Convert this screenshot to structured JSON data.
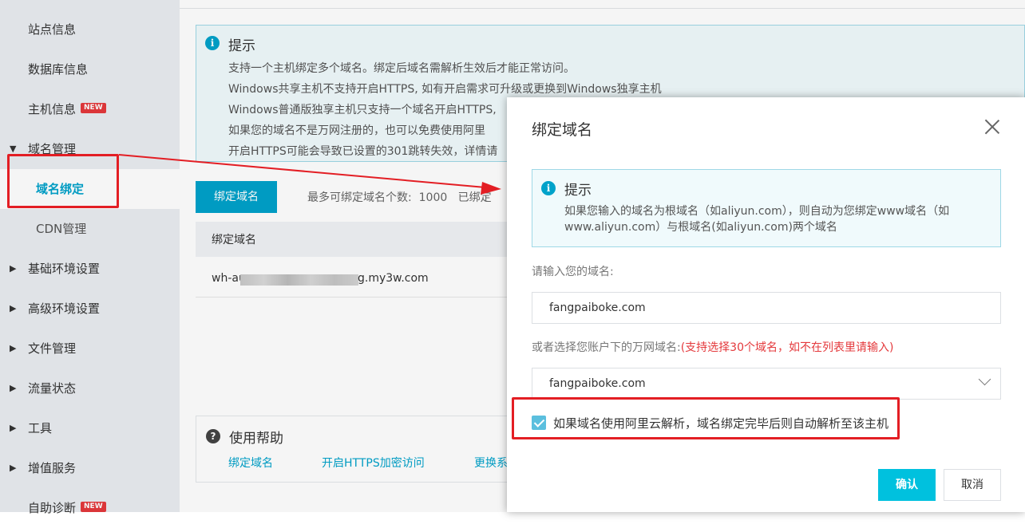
{
  "sidebar": {
    "items": [
      {
        "label": "站点信息",
        "arrow": ""
      },
      {
        "label": "数据库信息",
        "arrow": ""
      },
      {
        "label": "主机信息",
        "arrow": "",
        "badge": "NEW"
      },
      {
        "label": "域名管理",
        "arrow": "▼"
      },
      {
        "label": "域名绑定",
        "arrow": ""
      },
      {
        "label": "CDN管理",
        "arrow": ""
      },
      {
        "label": "基础环境设置",
        "arrow": "▶"
      },
      {
        "label": "高级环境设置",
        "arrow": "▶"
      },
      {
        "label": "文件管理",
        "arrow": "▶"
      },
      {
        "label": "流量状态",
        "arrow": "▶"
      },
      {
        "label": "工具",
        "arrow": "▶"
      },
      {
        "label": "增值服务",
        "arrow": "▶"
      },
      {
        "label": "自助诊断",
        "arrow": "",
        "badge": "NEW"
      }
    ]
  },
  "tips": {
    "title": "提示",
    "icon": "info-icon",
    "lines": [
      "支持一个主机绑定多个域名。绑定后域名需解析生效后才能正常访问。",
      "Windows共享主机不支持开启HTTPS, 如有开启需求可升级或更换到Windows独享主机",
      "Windows普通版独享主机只支持一个域名开启HTTPS,",
      "如果您的域名不是万网注册的，也可以免费使用阿里",
      "开启HTTPS可能会导致已设置的301跳转失效，详情请"
    ]
  },
  "toolbar": {
    "bind_button": "绑定域名",
    "max_label": "最多可绑定域名个数:",
    "max_value": "1000",
    "bound_label": "已绑定"
  },
  "table": {
    "header": "绑定域名",
    "rows": [
      {
        "prefix": "wh-au",
        "suffix": "g.my3w.com"
      }
    ]
  },
  "help": {
    "title": "使用帮助",
    "links": [
      "绑定域名",
      "开启HTTPS加密访问",
      "更换系"
    ]
  },
  "modal": {
    "title": "绑定域名",
    "tip_title": "提示",
    "tip_text": "如果您输入的域名为根域名（如aliyun.com），则自动为您绑定www域名（如www.aliyun.com）与根域名(如aliyun.com)两个域名",
    "domain_label": "请输入您的域名:",
    "domain_value": "fangpaiboke.com",
    "select_label": "或者选择您账户下的万网域名:",
    "select_note": "(支持选择30个域名，如不在列表里请输入)",
    "select_value": "fangpaiboke.com",
    "checkbox_checked": true,
    "checkbox_label": "如果域名使用阿里云解析，域名绑定完毕后则自动解析至该主机",
    "confirm": "确认",
    "cancel": "取消"
  },
  "colors": {
    "accent": "#00a2ca",
    "confirm": "#00c1de",
    "annotation_red": "#e31e24",
    "badge_red": "#e4393c"
  }
}
